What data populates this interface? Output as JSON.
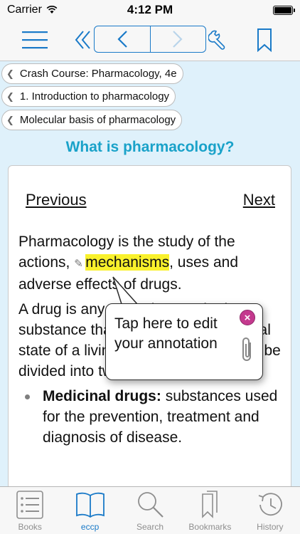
{
  "status_bar": {
    "carrier": "Carrier",
    "time": "4:12 PM"
  },
  "toolbar": {
    "menu_icon": "hamburger-icon",
    "back_all_icon": "double-chevron-left-icon",
    "prev_icon": "chevron-left-icon",
    "next_icon": "chevron-right-icon",
    "tools_icon": "wrench-icon",
    "bookmark_icon": "bookmark-icon"
  },
  "breadcrumbs": [
    {
      "label": "Crash Course: Pharmacology, 4e"
    },
    {
      "label": "1. Introduction to pharmacology"
    },
    {
      "label": "Molecular basis of pharmacology"
    }
  ],
  "page_title": "What is pharmacology?",
  "content": {
    "previous_label": "Previous",
    "next_label": "Next",
    "para1_a": "Pharmacology is the study of the actions, ",
    "para1_highlight": "mechanisms",
    "para1_b": ", uses and adverse effects of drugs.",
    "para2": "A drug is any natural or synthetic substance that alters the physiological state of a living organism. Drugs can be divided into two groups:",
    "bullets": [
      {
        "term": "Medicinal drugs:",
        "text": " substances used for the prevention, treatment and diagnosis of disease."
      }
    ]
  },
  "annotation_popup": {
    "text": "Tap here to edit your annotation",
    "close_icon": "close-icon",
    "attach_icon": "paperclip-icon"
  },
  "tabbar": {
    "tabs": [
      {
        "label": "Books",
        "icon": "list-icon",
        "active": false
      },
      {
        "label": "eccp",
        "icon": "open-book-icon",
        "active": true
      },
      {
        "label": "Search",
        "icon": "search-icon",
        "active": false
      },
      {
        "label": "Bookmarks",
        "icon": "bookmarks-icon",
        "active": false
      },
      {
        "label": "History",
        "icon": "history-icon",
        "active": false
      }
    ]
  },
  "colors": {
    "accent": "#1a7ac8",
    "title": "#1aa2c9",
    "highlight": "#f9f12c",
    "background": "#dff1fb"
  }
}
